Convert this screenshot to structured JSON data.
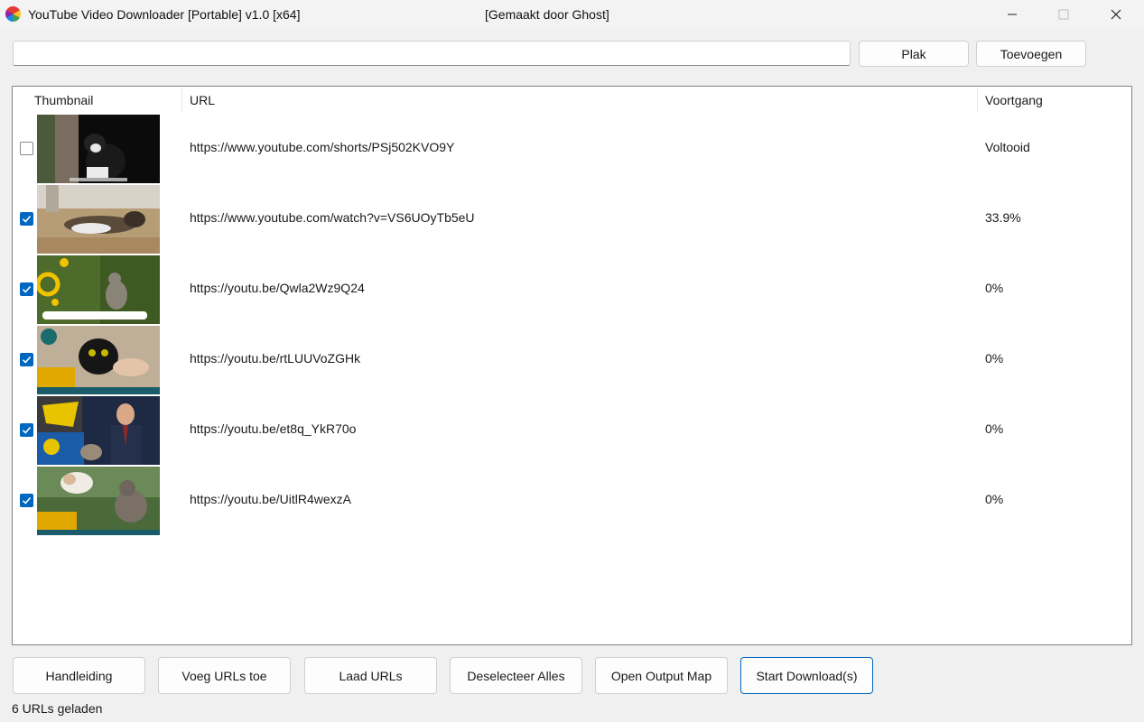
{
  "window": {
    "title": "YouTube Video Downloader [Portable] v1.0 [x64]",
    "credit": "[Gemaakt door Ghost]",
    "app_icon": "color-wheel-icon"
  },
  "toolbar": {
    "url_value": "",
    "paste_label": "Plak",
    "add_label": "Toevoegen"
  },
  "list": {
    "columns": [
      "Thumbnail",
      "URL",
      "Voortgang"
    ],
    "rows": [
      {
        "checked": false,
        "url": "https://www.youtube.com/shorts/PSj502KVO9Y",
        "progress": "Voltooid"
      },
      {
        "checked": true,
        "url": "https://www.youtube.com/watch?v=VS6UOyTb5eU",
        "progress": "33.9%"
      },
      {
        "checked": true,
        "url": "https://youtu.be/Qwla2Wz9Q24",
        "progress": "0%"
      },
      {
        "checked": true,
        "url": "https://youtu.be/rtLUUVoZGHk",
        "progress": "0%"
      },
      {
        "checked": true,
        "url": "https://youtu.be/et8q_YkR70o",
        "progress": "0%"
      },
      {
        "checked": true,
        "url": "https://youtu.be/UitlR4wexzA",
        "progress": "0%"
      }
    ]
  },
  "buttons": {
    "manual": "Handleiding",
    "add_urls": "Voeg URLs toe",
    "load_urls": "Laad URLs",
    "deselect_all": "Deselecteer Alles",
    "open_output": "Open Output Map",
    "start_download": "Start Download(s)"
  },
  "status": {
    "text": "6 URLs geladen"
  },
  "colors": {
    "accent": "#0067c0",
    "window_bg": "#f0f0f0",
    "list_bg": "#ffffff"
  }
}
